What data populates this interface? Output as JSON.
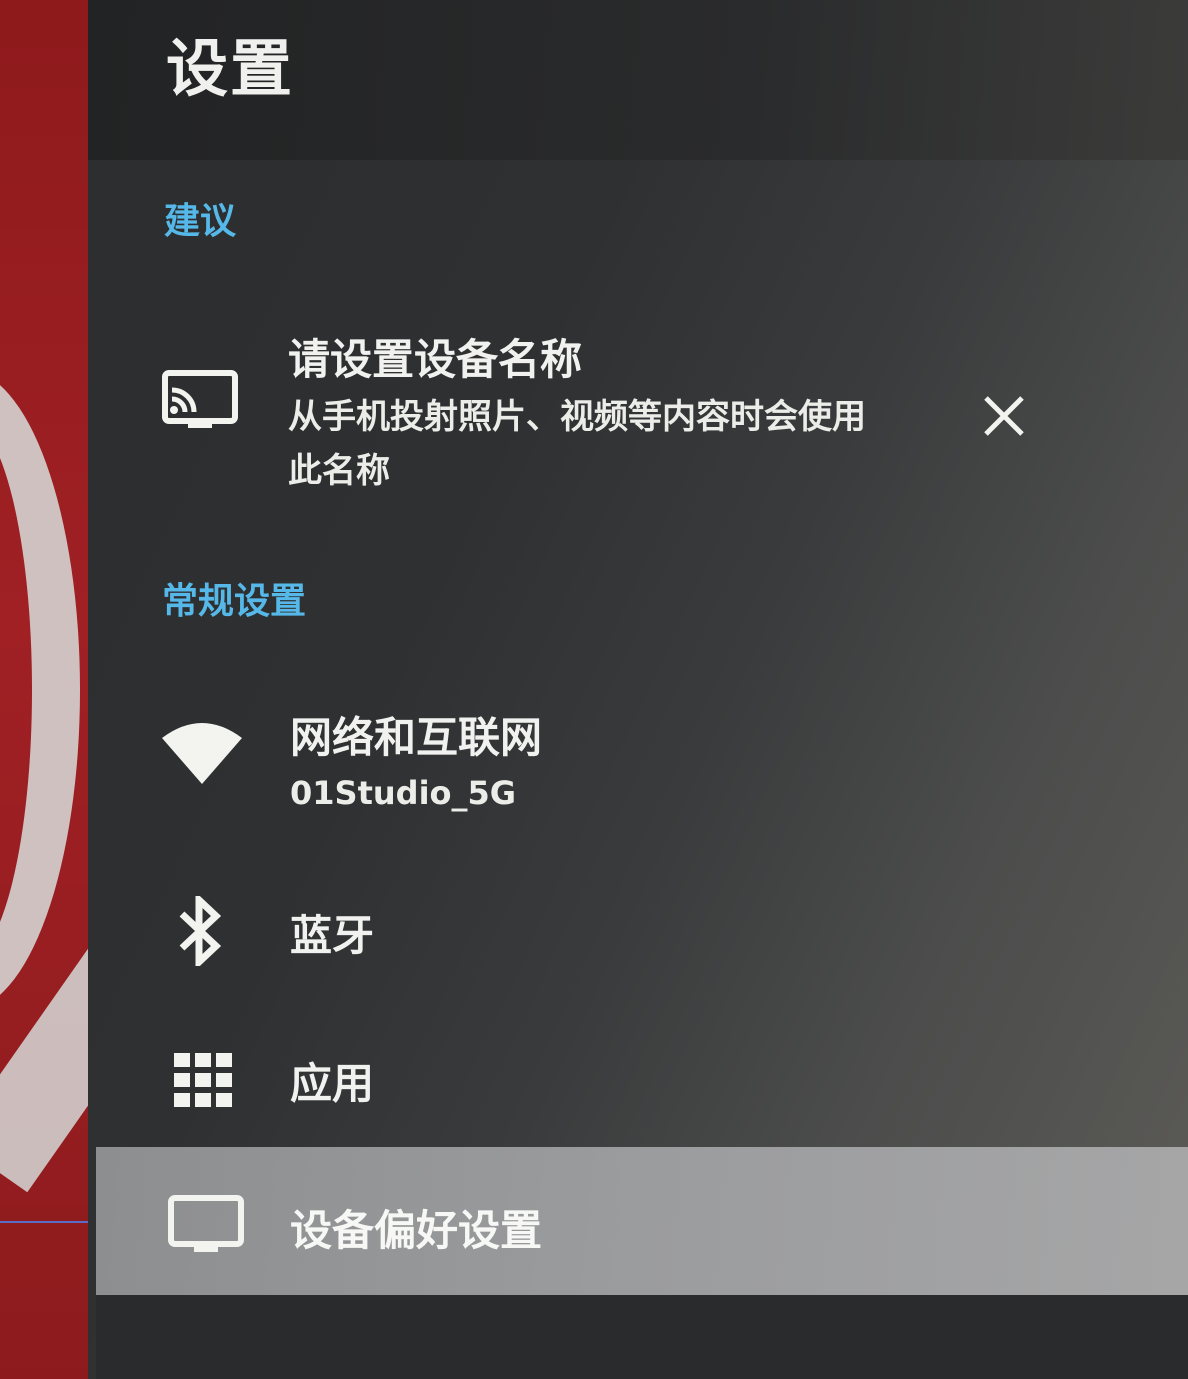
{
  "header": {
    "title": "设置"
  },
  "sections": {
    "suggestions": {
      "label": "建议",
      "card": {
        "title": "请设置设备名称",
        "description_line1": "从手机投射照片、视频等内容时会使用",
        "description_line2": "此名称",
        "icon": "cast-icon",
        "dismiss_icon": "close-icon"
      }
    },
    "general": {
      "label": "常规设置",
      "items": [
        {
          "title": "网络和互联网",
          "subtitle": "01Studio_5G",
          "icon": "wifi-icon"
        },
        {
          "title": "蓝牙",
          "icon": "bluetooth-icon"
        },
        {
          "title": "应用",
          "icon": "apps-grid-icon"
        },
        {
          "title": "设备偏好设置",
          "icon": "tv-monitor-icon",
          "selected": true
        }
      ]
    }
  },
  "colors": {
    "accent": "#56b8e8",
    "panel_bg": "#2b2c2d",
    "selected_bg": "#9b9c9e",
    "text": "#f1f1ef",
    "background_app": "#a02024"
  }
}
